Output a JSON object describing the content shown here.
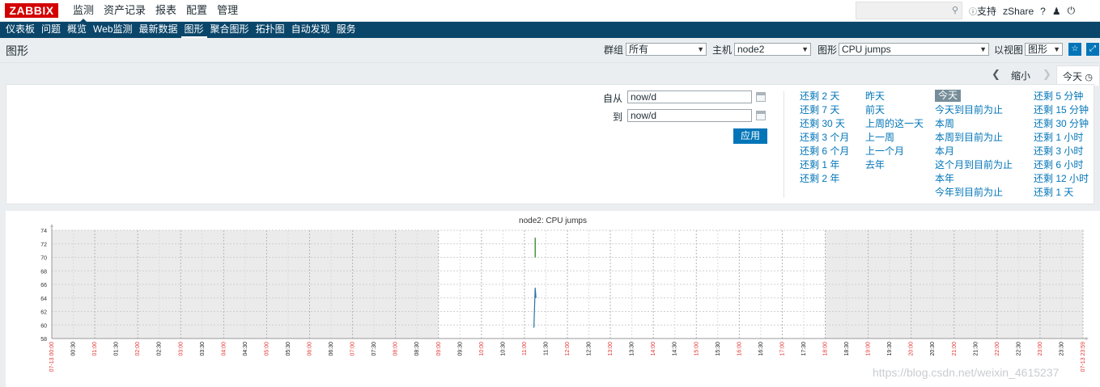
{
  "logo": "ZABBIX",
  "top_menu": [
    {
      "label": "监测",
      "active": true
    },
    {
      "label": "资产记录"
    },
    {
      "label": "报表"
    },
    {
      "label": "配置"
    },
    {
      "label": "管理"
    }
  ],
  "top_links": {
    "support": "支持",
    "share": "Share",
    "help": "?",
    "user_icon": "user-icon",
    "logout_icon": "power-icon"
  },
  "sub_menu": [
    {
      "label": "仪表板"
    },
    {
      "label": "问题"
    },
    {
      "label": "概览"
    },
    {
      "label": "Web监测"
    },
    {
      "label": "最新数据"
    },
    {
      "label": "图形",
      "active": true
    },
    {
      "label": "聚合图形"
    },
    {
      "label": "拓扑图"
    },
    {
      "label": "自动发现"
    },
    {
      "label": "服务"
    }
  ],
  "page": {
    "title": "图形",
    "group_label": "群组",
    "group_value": "所有",
    "host_label": "主机",
    "host_value": "node2",
    "graph_label": "图形",
    "graph_value": "CPU jumps",
    "view_label": "以视图",
    "view_value": "图形"
  },
  "time_nav": {
    "zoom_out": "缩小",
    "today": "今天"
  },
  "filter": {
    "from_label": "自从",
    "from_value": "now/d",
    "to_label": "到",
    "to_value": "now/d",
    "apply": "应用"
  },
  "quick_ranges": {
    "col1": [
      "还剩 2 天",
      "还剩 7 天",
      "还剩 30 天",
      "还剩 3 个月",
      "还剩 6 个月",
      "还剩 1 年",
      "还剩 2 年"
    ],
    "col2": [
      "昨天",
      "前天",
      "上周的这一天",
      "上一周",
      "上一个月",
      "去年"
    ],
    "col3": [
      "今天",
      "今天到目前为止",
      "本周",
      "本周到目前为止",
      "本月",
      "这个月到目前为止",
      "本年",
      "今年到目前为止"
    ],
    "col4": [
      "还剩 5 分钟",
      "还剩 15 分钟",
      "还剩 30 分钟",
      "还剩 1 小时",
      "还剩 3 小时",
      "还剩 6 小时",
      "还剩 12 小时",
      "还剩 1 天"
    ]
  },
  "chart_data": {
    "type": "line",
    "title": "node2: CPU jumps",
    "y_ticks": [
      "74",
      "72",
      "70",
      "68",
      "66",
      "64",
      "62",
      "60",
      "58"
    ],
    "ylim": [
      58,
      74
    ],
    "x_ticks": [
      "07-13 00:00",
      "00:30",
      "01:00",
      "01:30",
      "02:00",
      "02:30",
      "03:00",
      "03:30",
      "04:00",
      "04:30",
      "05:00",
      "05:30",
      "06:00",
      "06:30",
      "07:00",
      "07:30",
      "08:00",
      "08:30",
      "09:00",
      "09:30",
      "10:00",
      "10:30",
      "11:00",
      "11:30",
      "12:00",
      "12:30",
      "13:00",
      "13:30",
      "14:00",
      "14:30",
      "15:00",
      "15:30",
      "16:00",
      "16:30",
      "17:00",
      "17:30",
      "18:00",
      "18:30",
      "19:00",
      "19:30",
      "20:00",
      "20:30",
      "21:00",
      "21:30",
      "22:00",
      "22:30",
      "23:00",
      "23:30",
      "07-13 23:59"
    ],
    "shaded_ranges_hours": [
      [
        0,
        9
      ],
      [
        18,
        24
      ]
    ],
    "series": [
      {
        "color": "#1a7c11",
        "points": [
          [
            11.25,
            72.9
          ],
          [
            11.25,
            70.0
          ]
        ]
      },
      {
        "color": "#2774a4",
        "points": [
          [
            11.22,
            59.6
          ],
          [
            11.25,
            65.5
          ],
          [
            11.27,
            64.0
          ]
        ]
      }
    ],
    "grid": true
  },
  "watermark": "https://blog.csdn.net/weixin_4615237"
}
